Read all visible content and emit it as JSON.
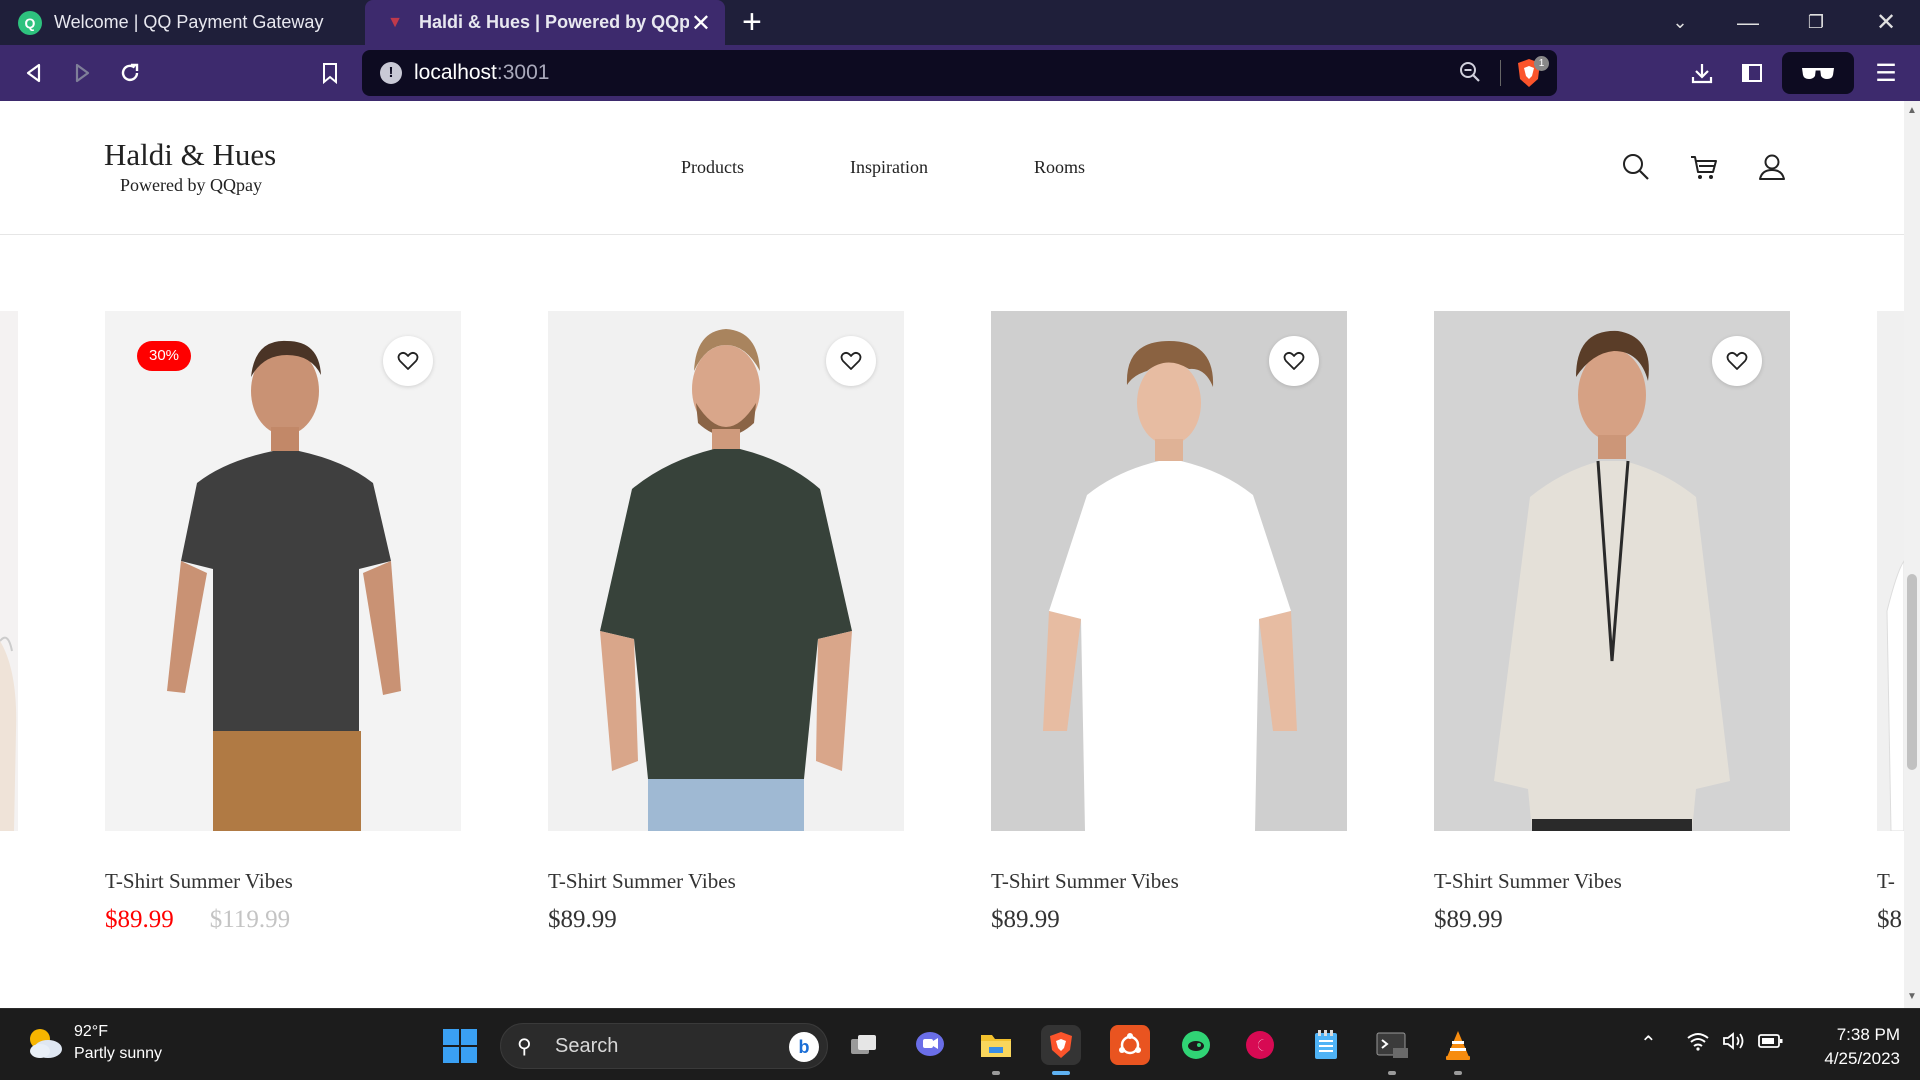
{
  "browser": {
    "tabs": [
      {
        "title": "Welcome | QQ Payment Gateway",
        "active": false
      },
      {
        "title": "Haldi & Hues | Powered by QQpay",
        "active": true
      }
    ],
    "url_host": "localhost",
    "url_port": ":3001",
    "shield_count": "1"
  },
  "site": {
    "brand_name": "Haldi & Hues",
    "brand_tagline": "Powered by QQpay",
    "nav": [
      "Products",
      "Inspiration",
      "Rooms"
    ]
  },
  "products": [
    {
      "title": "T-Shirt Summer Vibes",
      "price": "$89.99",
      "old_price": "$119.99",
      "discount": "30%",
      "shirt_color": "#3f3f3f"
    },
    {
      "title": "T-Shirt Summer Vibes",
      "price": "$89.99",
      "shirt_color": "#37423a"
    },
    {
      "title": "T-Shirt Summer Vibes",
      "price": "$89.99",
      "shirt_color": "#ffffff"
    },
    {
      "title": "T-Shirt Summer Vibes",
      "price": "$89.99",
      "shirt_color": "#e4e0d8"
    }
  ],
  "edge_card_right": {
    "title_fragment": "T-",
    "price_fragment": "$8"
  },
  "taskbar": {
    "weather_temp": "92°F",
    "weather_desc": "Partly sunny",
    "search_placeholder": "Search",
    "time": "7:38 PM",
    "date": "4/25/2023"
  },
  "colors": {
    "tab_bar": "#1f1f3a",
    "toolbar": "#3d2a6d",
    "sale_red": "#ff0000",
    "old_price_gray": "#c4c4c4"
  }
}
